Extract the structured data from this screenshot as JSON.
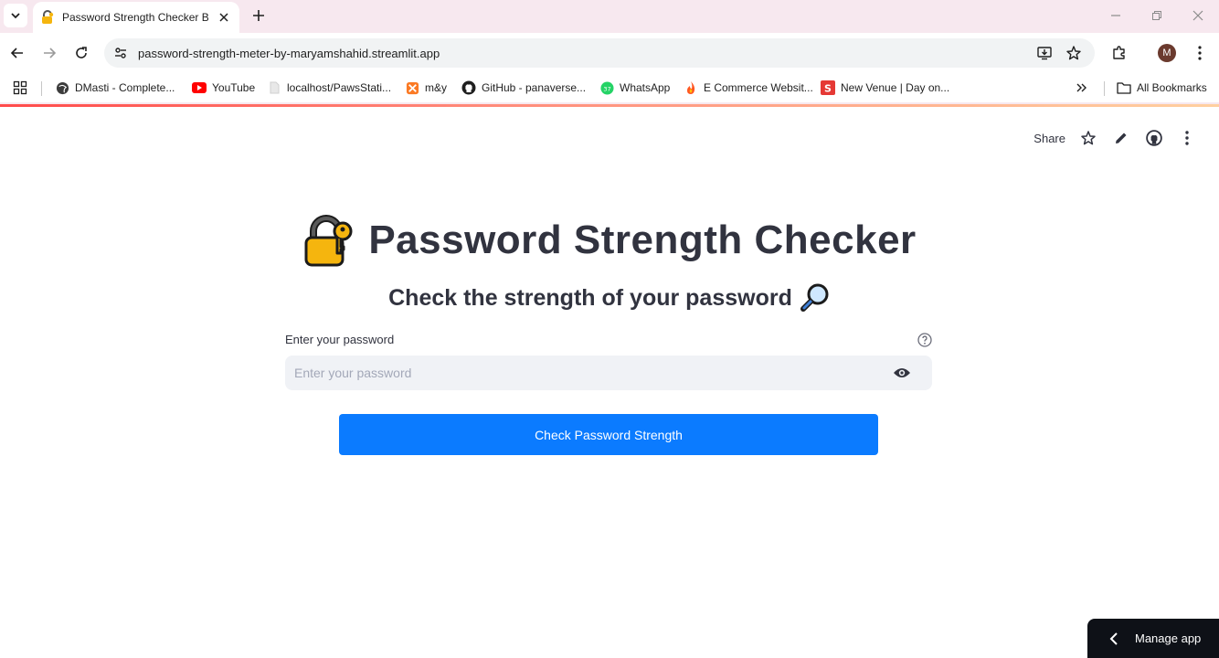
{
  "browser": {
    "tab_title": "Password Strength Checker By M",
    "url": "password-strength-meter-by-maryamshahid.streamlit.app",
    "profile_initial": "M",
    "bookmarks": [
      {
        "label": "DMasti - Complete...",
        "icon": "globe-icon"
      },
      {
        "label": "YouTube",
        "icon": "youtube-icon"
      },
      {
        "label": "localhost/PawsStati...",
        "icon": "page-icon"
      },
      {
        "label": "m&y",
        "icon": "xampp-icon"
      },
      {
        "label": "GitHub - panaverse...",
        "icon": "github-icon"
      },
      {
        "label": "WhatsApp",
        "icon": "whatsapp-icon"
      },
      {
        "label": "E Commerce Websit...",
        "icon": "fire-icon"
      },
      {
        "label": "New Venue | Day on...",
        "icon": "s-brand-icon"
      }
    ],
    "all_bookmarks_label": "All Bookmarks"
  },
  "app_header": {
    "share_label": "Share"
  },
  "main": {
    "title": "Password Strength Checker",
    "subtitle": "Check the strength of your password",
    "password_label": "Enter your password",
    "password_placeholder": "Enter your password",
    "password_value": "",
    "check_button_label": "Check Password Strength"
  },
  "footer": {
    "manage_app_label": "Manage app"
  },
  "colors": {
    "primary_button": "#0b7bff",
    "text": "#31333f",
    "input_bg": "#f0f2f6",
    "chrome_frame": "#f7e8ef"
  }
}
